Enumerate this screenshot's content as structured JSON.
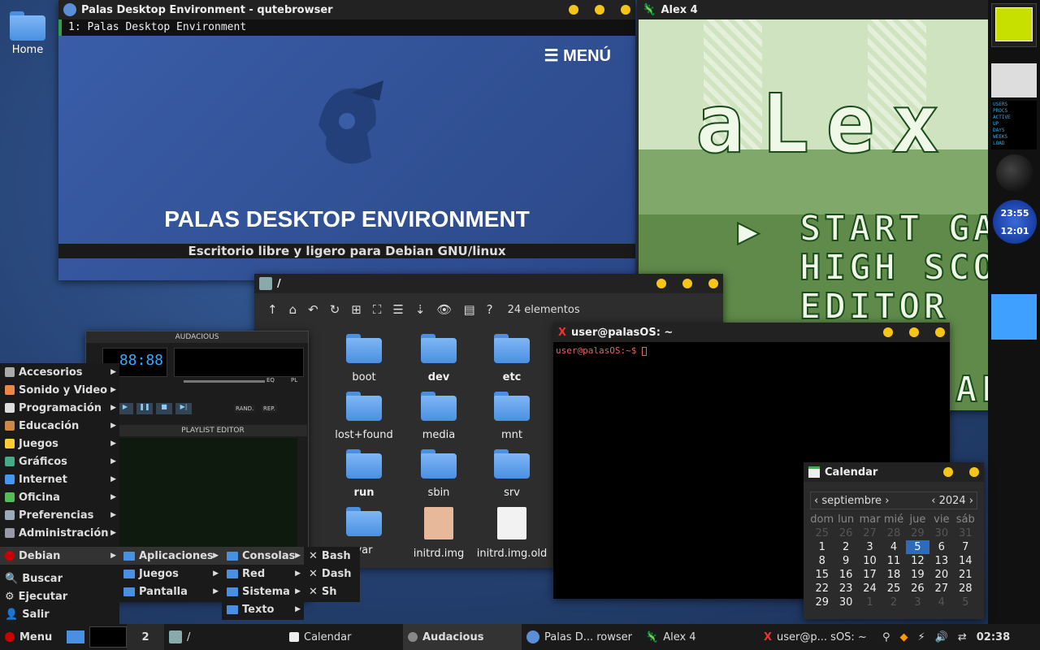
{
  "desktop": {
    "home_label": "Home"
  },
  "browser": {
    "title": "Palas Desktop Environment - qutebrowser",
    "tab": "1: Palas Desktop Environment",
    "menu": "MENÚ",
    "heading": "PALAS DESKTOP ENVIRONMENT",
    "subheading": "Escritorio libre y ligero para Debian GNU/linux"
  },
  "alex": {
    "title": "Alex 4",
    "logo": "aLex",
    "items": [
      "START GA",
      "HIGH SCO",
      "EDITOR"
    ],
    "bottom": "ALLEN"
  },
  "filemanager": {
    "title": "/",
    "count": "24 elementos",
    "items": [
      {
        "name": "boot",
        "bold": false
      },
      {
        "name": "dev",
        "bold": true
      },
      {
        "name": "etc",
        "bold": true
      },
      {
        "name": "lost+found",
        "bold": false
      },
      {
        "name": "media",
        "bold": false
      },
      {
        "name": "mnt",
        "bold": false
      },
      {
        "name": "run",
        "bold": true
      },
      {
        "name": "sbin",
        "bold": false
      },
      {
        "name": "srv",
        "bold": false
      },
      {
        "name": "var",
        "bold": false
      },
      {
        "name": "initrd.img",
        "bold": false
      },
      {
        "name": "initrd.img.old",
        "bold": false
      }
    ]
  },
  "audacious": {
    "title": "AUDACIOUS",
    "playlist": "PLAYLIST EDITOR",
    "time": "88:88",
    "eq": "EQ",
    "pl": "PL",
    "rand": "RAND.",
    "rep": "REP."
  },
  "terminal": {
    "title": "user@palasOS: ~",
    "prompt": "user@palasOS:~$ "
  },
  "calendar": {
    "title": "Calendar",
    "month": "septiembre",
    "year": "2024",
    "days": [
      "dom",
      "lun",
      "mar",
      "mié",
      "jue",
      "vie",
      "sáb"
    ],
    "weeks": [
      [
        "25",
        "26",
        "27",
        "28",
        "29",
        "30",
        "31"
      ],
      [
        "1",
        "2",
        "3",
        "4",
        "5",
        "6",
        "7"
      ],
      [
        "8",
        "9",
        "10",
        "11",
        "12",
        "13",
        "14"
      ],
      [
        "15",
        "16",
        "17",
        "18",
        "19",
        "20",
        "21"
      ],
      [
        "22",
        "23",
        "24",
        "25",
        "26",
        "27",
        "28"
      ],
      [
        "29",
        "30",
        "1",
        "2",
        "3",
        "4",
        "5"
      ]
    ],
    "selected": "5"
  },
  "dock": {
    "clock1": "23:55",
    "clock2": "12:01",
    "stats": [
      "USERS",
      "PROCS",
      "ACTIVE",
      "UP",
      "DAYS",
      "WEEKS",
      "LOAD"
    ]
  },
  "menu": {
    "items": [
      "Accesorios",
      "Sonido y Video",
      "Programación",
      "Educación",
      "Juegos",
      "Gráficos",
      "Internet",
      "Oficina",
      "Preferencias",
      "Administración"
    ],
    "debian": "Debian",
    "buscar": "Buscar",
    "ejecutar": "Ejecutar",
    "salir": "Salir",
    "sub1": [
      "Aplicaciones",
      "Juegos",
      "Pantalla"
    ],
    "sub2": [
      "Consolas",
      "Red",
      "Sistema",
      "Texto"
    ],
    "sub3": [
      "Bash",
      "Dash",
      "Sh"
    ]
  },
  "taskbar": {
    "menu": "Menu",
    "workspace": "2",
    "tasks": [
      "/",
      "Calendar",
      "Audacious",
      "Palas D... rowser",
      "Alex 4",
      "user@p... sOS: ~"
    ],
    "time": "02:38"
  }
}
